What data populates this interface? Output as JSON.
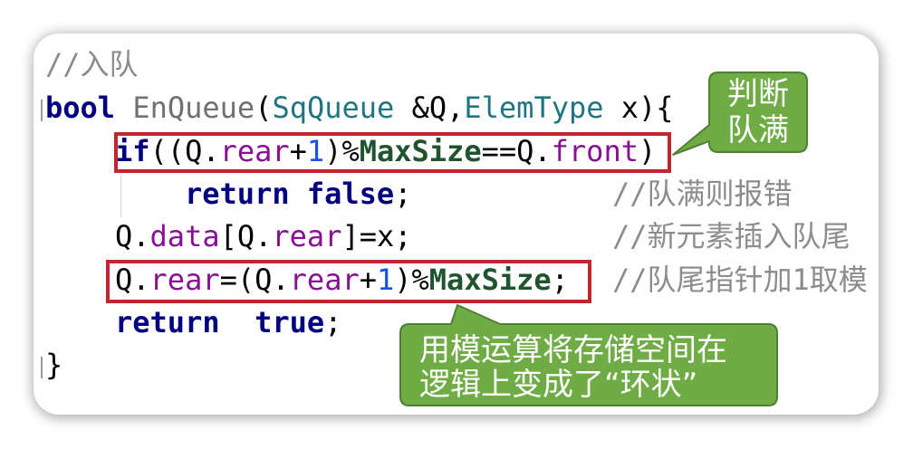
{
  "colors": {
    "background": "#ffffff",
    "keyword": "#000080",
    "function_name": "#707070",
    "type": "#20757f",
    "field": "#871094",
    "number": "#1750eb",
    "macro": "#1f542e",
    "comment": "#8c8c8c",
    "plain": "#000000",
    "highlight_box": "#c0262d",
    "callout_fill": "#6fac46",
    "callout_border": "#4f7f32",
    "callout_text": "#ffffff"
  },
  "code": {
    "lines": [
      {
        "tokens": [
          "//入队"
        ]
      },
      {
        "tokens": [
          "bool",
          " EnQueue",
          "(",
          "SqQueue",
          " &Q,",
          "ElemType",
          " x){"
        ]
      },
      {
        "tokens": [
          "if",
          "((Q.",
          "rear",
          "+",
          "1",
          ")%",
          "MaxSize",
          "==Q.",
          "front",
          ")"
        ]
      },
      {
        "tokens": [
          "return false",
          ";"
        ],
        "comment": "//队满则报错"
      },
      {
        "tokens": [
          "Q.",
          "data",
          "[Q.",
          "rear",
          "]=x;"
        ],
        "comment": "//新元素插入队尾"
      },
      {
        "tokens": [
          "Q.",
          "rear",
          "=(Q.",
          "rear",
          "+",
          "1",
          ")%",
          "MaxSize",
          ";"
        ],
        "comment": "//队尾指针加1取模"
      },
      {
        "tokens": [
          "return  true",
          ";"
        ]
      },
      {
        "tokens": [
          "}"
        ]
      }
    ]
  },
  "callouts": {
    "full_check": {
      "lines": [
        "判断",
        "队满"
      ]
    },
    "modulo_note": {
      "lines": [
        "用模运算将存储空间在",
        "逻辑上变成了“环状”"
      ]
    }
  }
}
